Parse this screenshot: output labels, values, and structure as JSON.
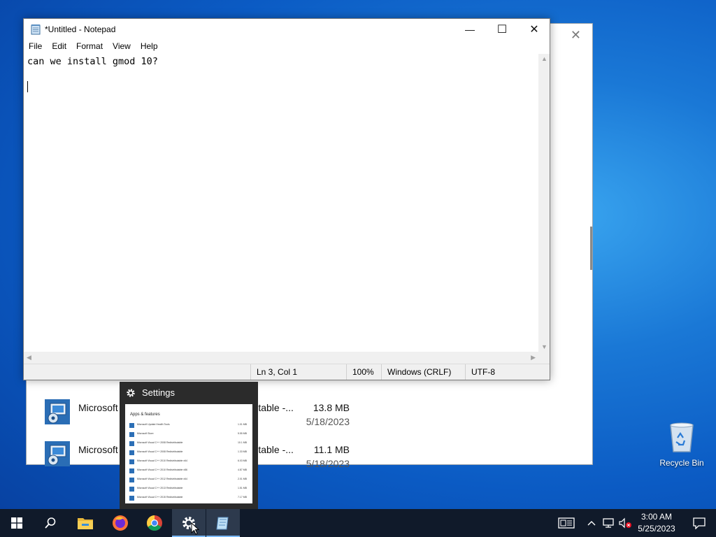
{
  "settings_window": {
    "close_glyph": "✕",
    "apps": [
      {
        "name": "Microsoft Visual C++ 2010 x64 Redistributable -...",
        "size": "13.8 MB",
        "date": "5/18/2023",
        "icon": "installer-icon"
      },
      {
        "name": "Microsoft Visual C++ 2010 x86 Redistributable -...",
        "size": "11.1 MB",
        "date": "5/18/2023",
        "icon": "installer-icon"
      }
    ]
  },
  "notepad": {
    "title": "*Untitled - Notepad",
    "controls": {
      "minimize": "—",
      "maximize": "☐",
      "close": "✕"
    },
    "menu": [
      "File",
      "Edit",
      "Format",
      "View",
      "Help"
    ],
    "content": "can we install gmod 10?",
    "status": {
      "position": "Ln 3, Col 1",
      "zoom": "100%",
      "line_ending": "Windows (CRLF)",
      "encoding": "UTF-8"
    }
  },
  "thumbnail": {
    "title": "Settings",
    "preview_header": "Apps & features",
    "preview_rows": [
      {
        "name": "Microsoft Update Health Tools",
        "size": "1.01 MB"
      },
      {
        "name": "Microsoft Store",
        "size": "5.55 MB"
      },
      {
        "name": "Microsoft Visual C++ 2008 Redistributable",
        "size": "10.1 MB"
      },
      {
        "name": "Microsoft Visual C++ 2008 Redistributable",
        "size": "1.33 MB"
      },
      {
        "name": "Microsoft Visual C++ 2010 Redistributable x64",
        "size": "6.03 MB"
      },
      {
        "name": "Microsoft Visual C++ 2010 Redistributable x86",
        "size": "4.87 MB"
      },
      {
        "name": "Microsoft Visual C++ 2012 Redistributable x64",
        "size": "2.01 MB"
      },
      {
        "name": "Microsoft Visual C++ 2013 Redistributable",
        "size": "1.51 MB"
      },
      {
        "name": "Microsoft Visual C++ 2015 Redistributable",
        "size": "7.17 MB"
      }
    ]
  },
  "desktop": {
    "recycle_bin_label": "Recycle Bin"
  },
  "taskbar": {
    "clock_time": "3:00 AM",
    "clock_date": "5/25/2023",
    "apps": [
      "start-icon",
      "search-icon",
      "file-explorer-icon",
      "firefox-icon",
      "chrome-icon",
      "settings-icon",
      "notepad-icon"
    ]
  },
  "colors": {
    "accent": "#0078d7",
    "taskbar": "#101a2a",
    "highlight": "#7ab8f5"
  }
}
